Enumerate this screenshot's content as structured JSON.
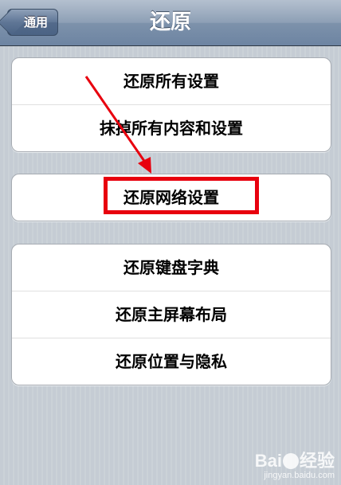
{
  "navbar": {
    "title": "还原",
    "back_label": "通用"
  },
  "groups": [
    {
      "items": [
        {
          "label": "还原所有设置"
        },
        {
          "label": "抹掉所有内容和设置"
        }
      ]
    },
    {
      "items": [
        {
          "label": "还原网络设置"
        }
      ]
    },
    {
      "items": [
        {
          "label": "还原键盘字典"
        },
        {
          "label": "还原主屏幕布局"
        },
        {
          "label": "还原位置与隐私"
        }
      ]
    }
  ],
  "annotation": {
    "color": "#e8000e"
  },
  "watermark": {
    "brand_left": "Bai",
    "brand_right": "经验",
    "url": "jingyan.baidu.com"
  }
}
